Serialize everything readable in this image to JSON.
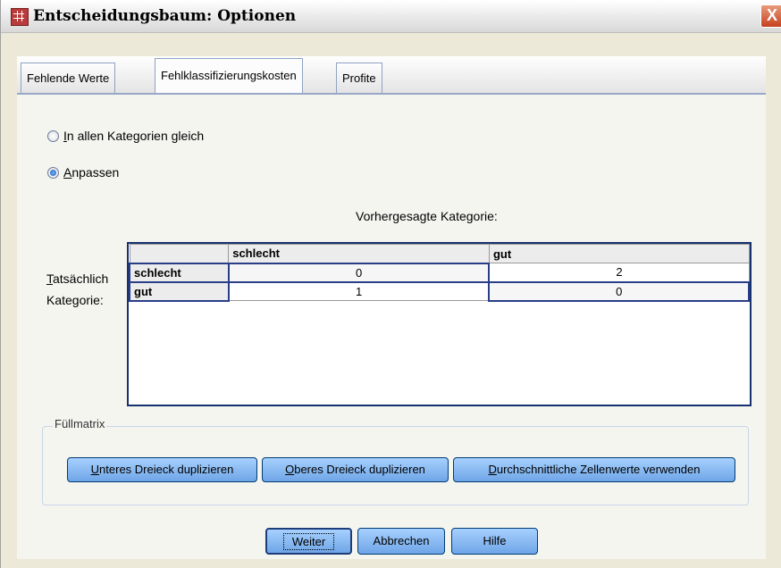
{
  "window": {
    "title": "Entscheidungsbaum: Optionen",
    "icon": "table-grid-icon",
    "close_glyph": "X"
  },
  "tabs": [
    {
      "label": "Fehlende Werte",
      "active": false
    },
    {
      "label": "Fehlklassifizierungskosten",
      "active": true
    },
    {
      "label": "Profite",
      "active": false
    }
  ],
  "cost_options": {
    "equal": {
      "pre": "",
      "mnemonic": "I",
      "post": "n allen Kategorien gleich",
      "checked": false
    },
    "custom": {
      "pre": "",
      "mnemonic": "A",
      "post": "npassen",
      "checked": true
    }
  },
  "matrix": {
    "predicted_label": "Vorhergesagte Kategorie:",
    "actual_label_line1_pre": "",
    "actual_label_line1_mnemonic": "T",
    "actual_label_line1_post": "atsächlich",
    "actual_label_line2": "Kategorie:",
    "columns": [
      "",
      "schlecht",
      "gut"
    ],
    "rows": [
      {
        "label": "schlecht",
        "values": [
          "0",
          "2"
        ]
      },
      {
        "label": "gut",
        "values": [
          "1",
          "0"
        ]
      }
    ]
  },
  "fill_matrix": {
    "legend": "Füllmatrix",
    "buttons": [
      {
        "pre": "",
        "mnemonic": "U",
        "post": "nteres Dreieck duplizieren"
      },
      {
        "pre": "",
        "mnemonic": "O",
        "post": "beres Dreieck duplizieren"
      },
      {
        "pre": "",
        "mnemonic": "D",
        "post": "urchschnittliche Zellenwerte verwenden"
      }
    ]
  },
  "footer": {
    "continue": "Weiter",
    "cancel": "Abbrechen",
    "help": "Hilfe"
  },
  "colors": {
    "window_bg": "#ece9d8",
    "panel_bg": "#f5f5f0",
    "button_blue": "#8bbbf2",
    "grid_border": "#16316d",
    "close_red": "#c6411e"
  }
}
